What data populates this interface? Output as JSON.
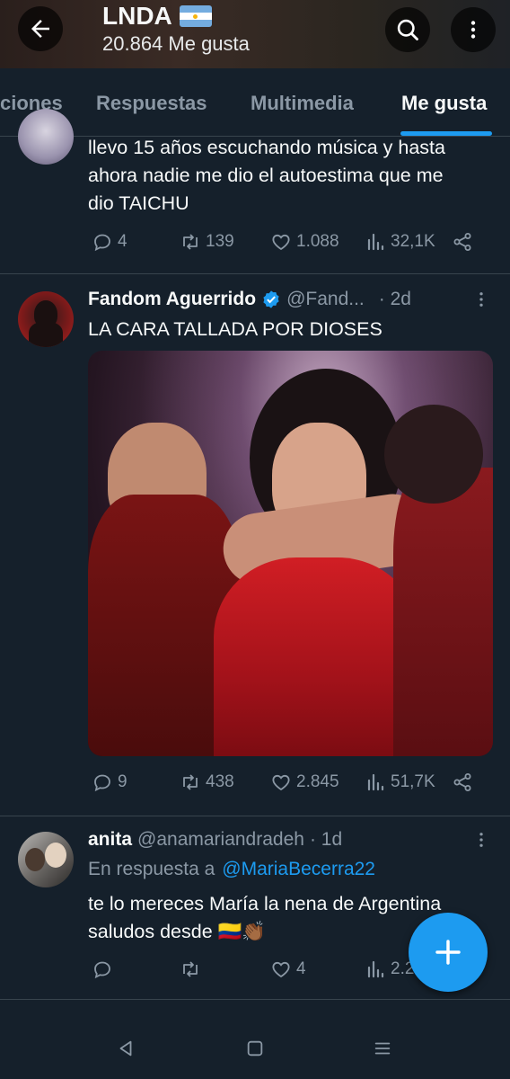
{
  "header": {
    "title": "LNDA",
    "flag_icon": "argentina-flag-icon",
    "subtitle": "20.864 Me gusta"
  },
  "tabs": [
    {
      "label": "ciones"
    },
    {
      "label": "Respuestas"
    },
    {
      "label": "Multimedia"
    },
    {
      "label": "Me gusta",
      "active": true
    }
  ],
  "tweets": [
    {
      "text_lines": [
        "llevo 15 años escuchando música y hasta",
        "ahora nadie me dio el autoestima que me",
        "dio TAICHU"
      ],
      "replies": "4",
      "retweets": "139",
      "likes": "1.088",
      "views": "32,1K"
    },
    {
      "name": "Fandom Aguerrido",
      "verified": true,
      "handle": "@Fand...",
      "time": "· 2d",
      "text": "LA CARA TALLADA POR DIOSES",
      "replies": "9",
      "retweets": "438",
      "likes": "2.845",
      "views": "51,7K"
    },
    {
      "name": "anita",
      "handle": "@anamariandradeh",
      "time": "· 1d",
      "reply_prefix": "En respuesta a",
      "reply_to": "@MariaBecerra22",
      "text_line1": "te lo mereces María la nena de Argentina",
      "text_line2": "saludos desde",
      "emoji": "🇨🇴👏🏾",
      "replies": "",
      "retweets": "",
      "likes": "4",
      "views": "2.2"
    }
  ],
  "colors": {
    "background": "#15202b",
    "accent": "#1d9bf0",
    "muted": "#8b98a5",
    "divider": "#38444d"
  }
}
